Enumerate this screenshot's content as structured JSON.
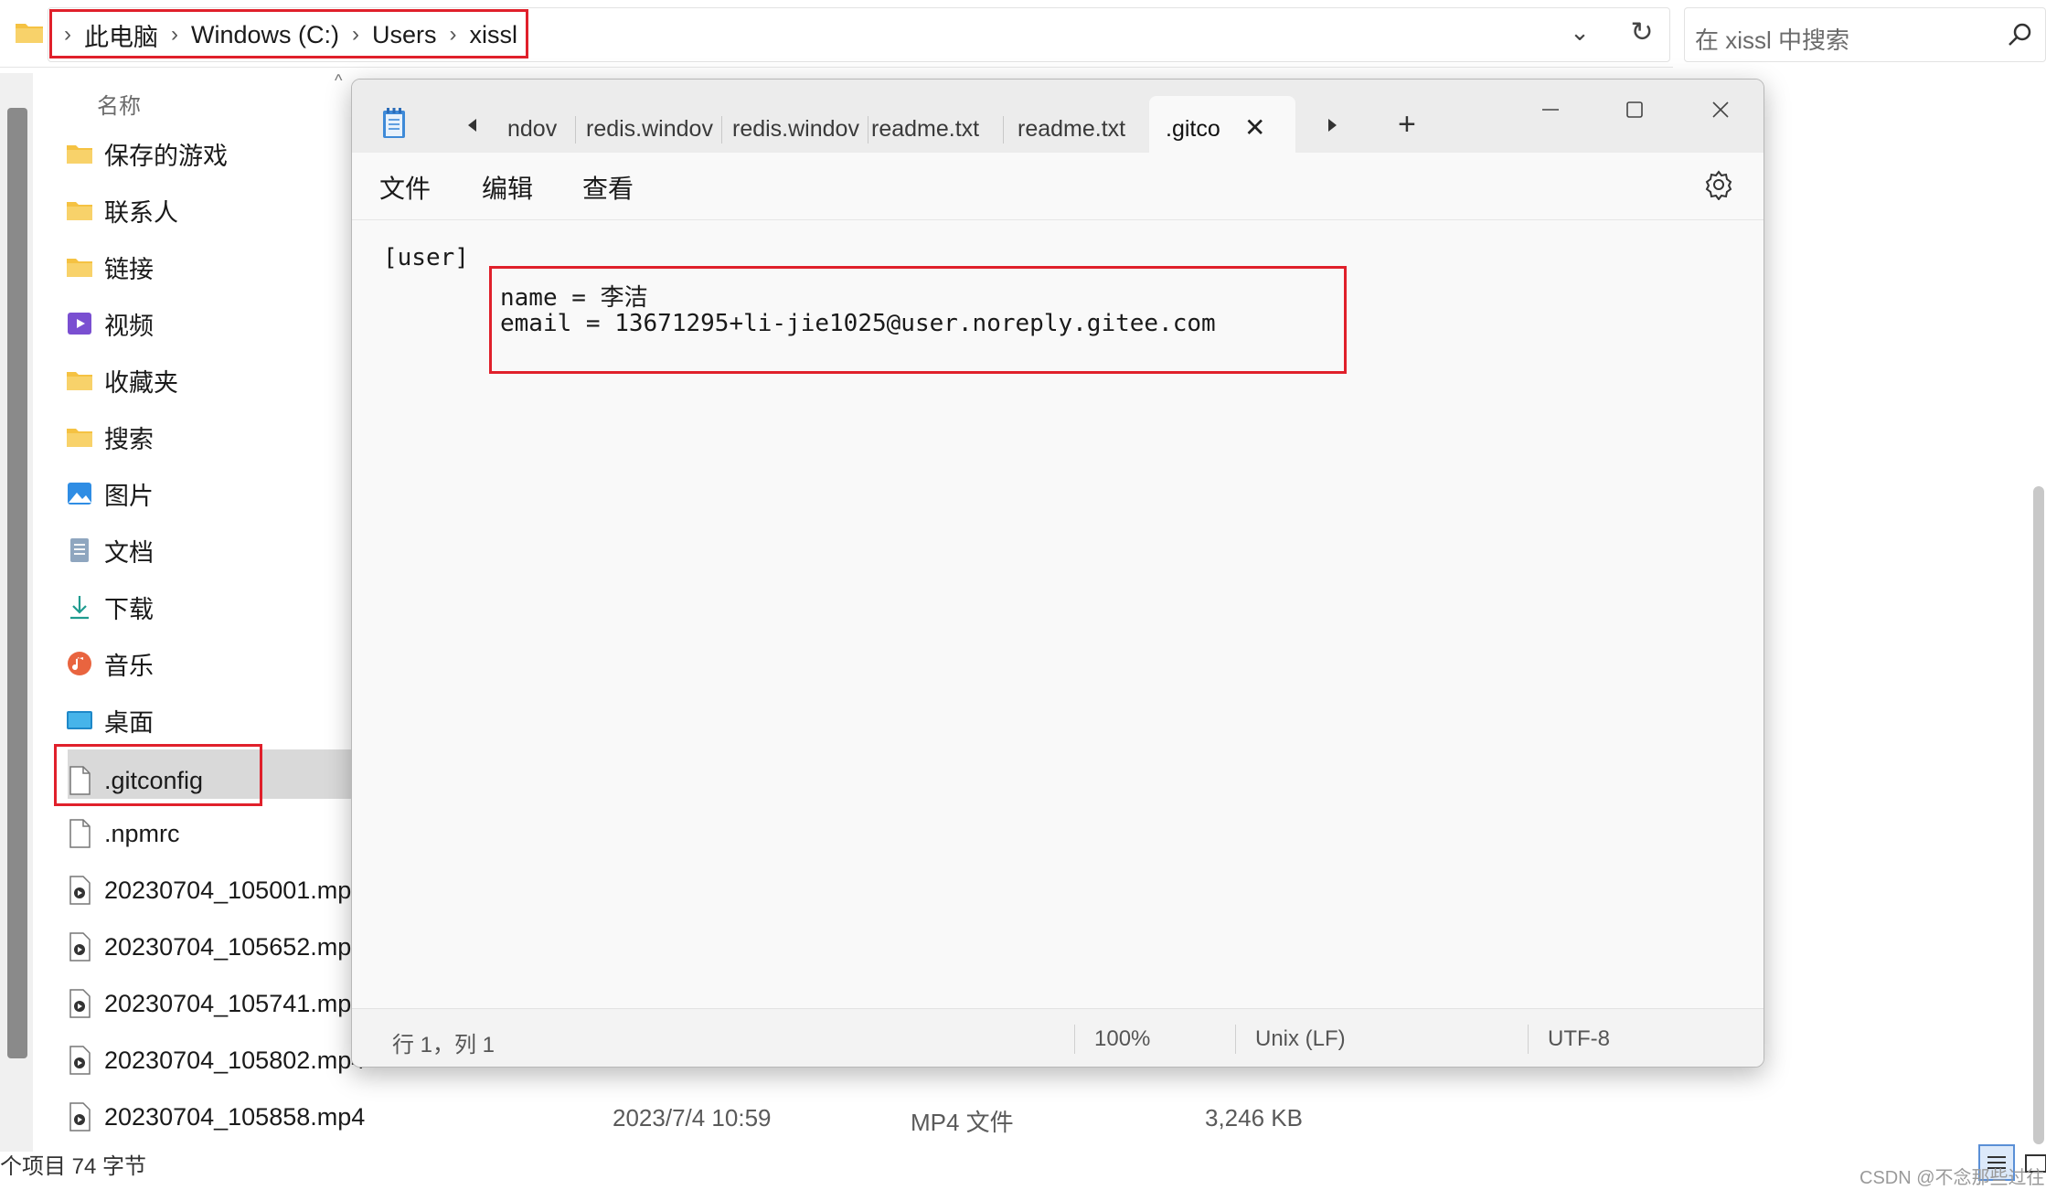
{
  "explorer": {
    "breadcrumbs": [
      "此电脑",
      "Windows (C:)",
      "Users",
      "xissl"
    ],
    "search_placeholder": "在 xissl 中搜索",
    "column_name": "名称",
    "items": [
      {
        "name": "保存的游戏",
        "icon": "folder-icon"
      },
      {
        "name": "联系人",
        "icon": "folder-icon"
      },
      {
        "name": "链接",
        "icon": "folder-icon"
      },
      {
        "name": "视频",
        "icon": "video-folder-icon"
      },
      {
        "name": "收藏夹",
        "icon": "folder-icon"
      },
      {
        "name": "搜索",
        "icon": "folder-icon"
      },
      {
        "name": "图片",
        "icon": "pictures-folder-icon"
      },
      {
        "name": "文档",
        "icon": "documents-folder-icon"
      },
      {
        "name": "下载",
        "icon": "download-folder-icon"
      },
      {
        "name": "音乐",
        "icon": "music-folder-icon"
      },
      {
        "name": "桌面",
        "icon": "desktop-folder-icon"
      },
      {
        "name": ".gitconfig",
        "icon": "file-icon"
      },
      {
        "name": ".npmrc",
        "icon": "file-icon"
      },
      {
        "name": "20230704_105001.mp4",
        "icon": "video-file-icon"
      },
      {
        "name": "20230704_105652.mp4",
        "icon": "video-file-icon"
      },
      {
        "name": "20230704_105741.mp4",
        "icon": "video-file-icon"
      },
      {
        "name": "20230704_105802.mp4",
        "icon": "video-file-icon"
      },
      {
        "name": "20230704_105858.mp4",
        "icon": "video-file-icon"
      }
    ],
    "last_row_meta": {
      "date": "2023/7/4 10:59",
      "type": "MP4 文件",
      "size": "3,246 KB"
    },
    "status_left": "个项目  74 字节",
    "watermark": "CSDN @不念那些过往"
  },
  "notepad": {
    "tabs": [
      "ndov",
      "redis.windov",
      "redis.windov",
      "readme.txt",
      "readme.txt"
    ],
    "active_tab": ".gitco",
    "menu": [
      "文件",
      "编辑",
      "查看"
    ],
    "content": {
      "line1": "[user]",
      "line2": "name = 李洁",
      "line3": "email = 13671295+li-jie1025@user.noreply.gitee.com"
    },
    "status": {
      "position": "行 1，列 1",
      "zoom": "100%",
      "line_ending": "Unix (LF)",
      "encoding": "UTF-8"
    }
  },
  "colors": {
    "highlight": "#e0202b",
    "folder": "#f5c242"
  }
}
